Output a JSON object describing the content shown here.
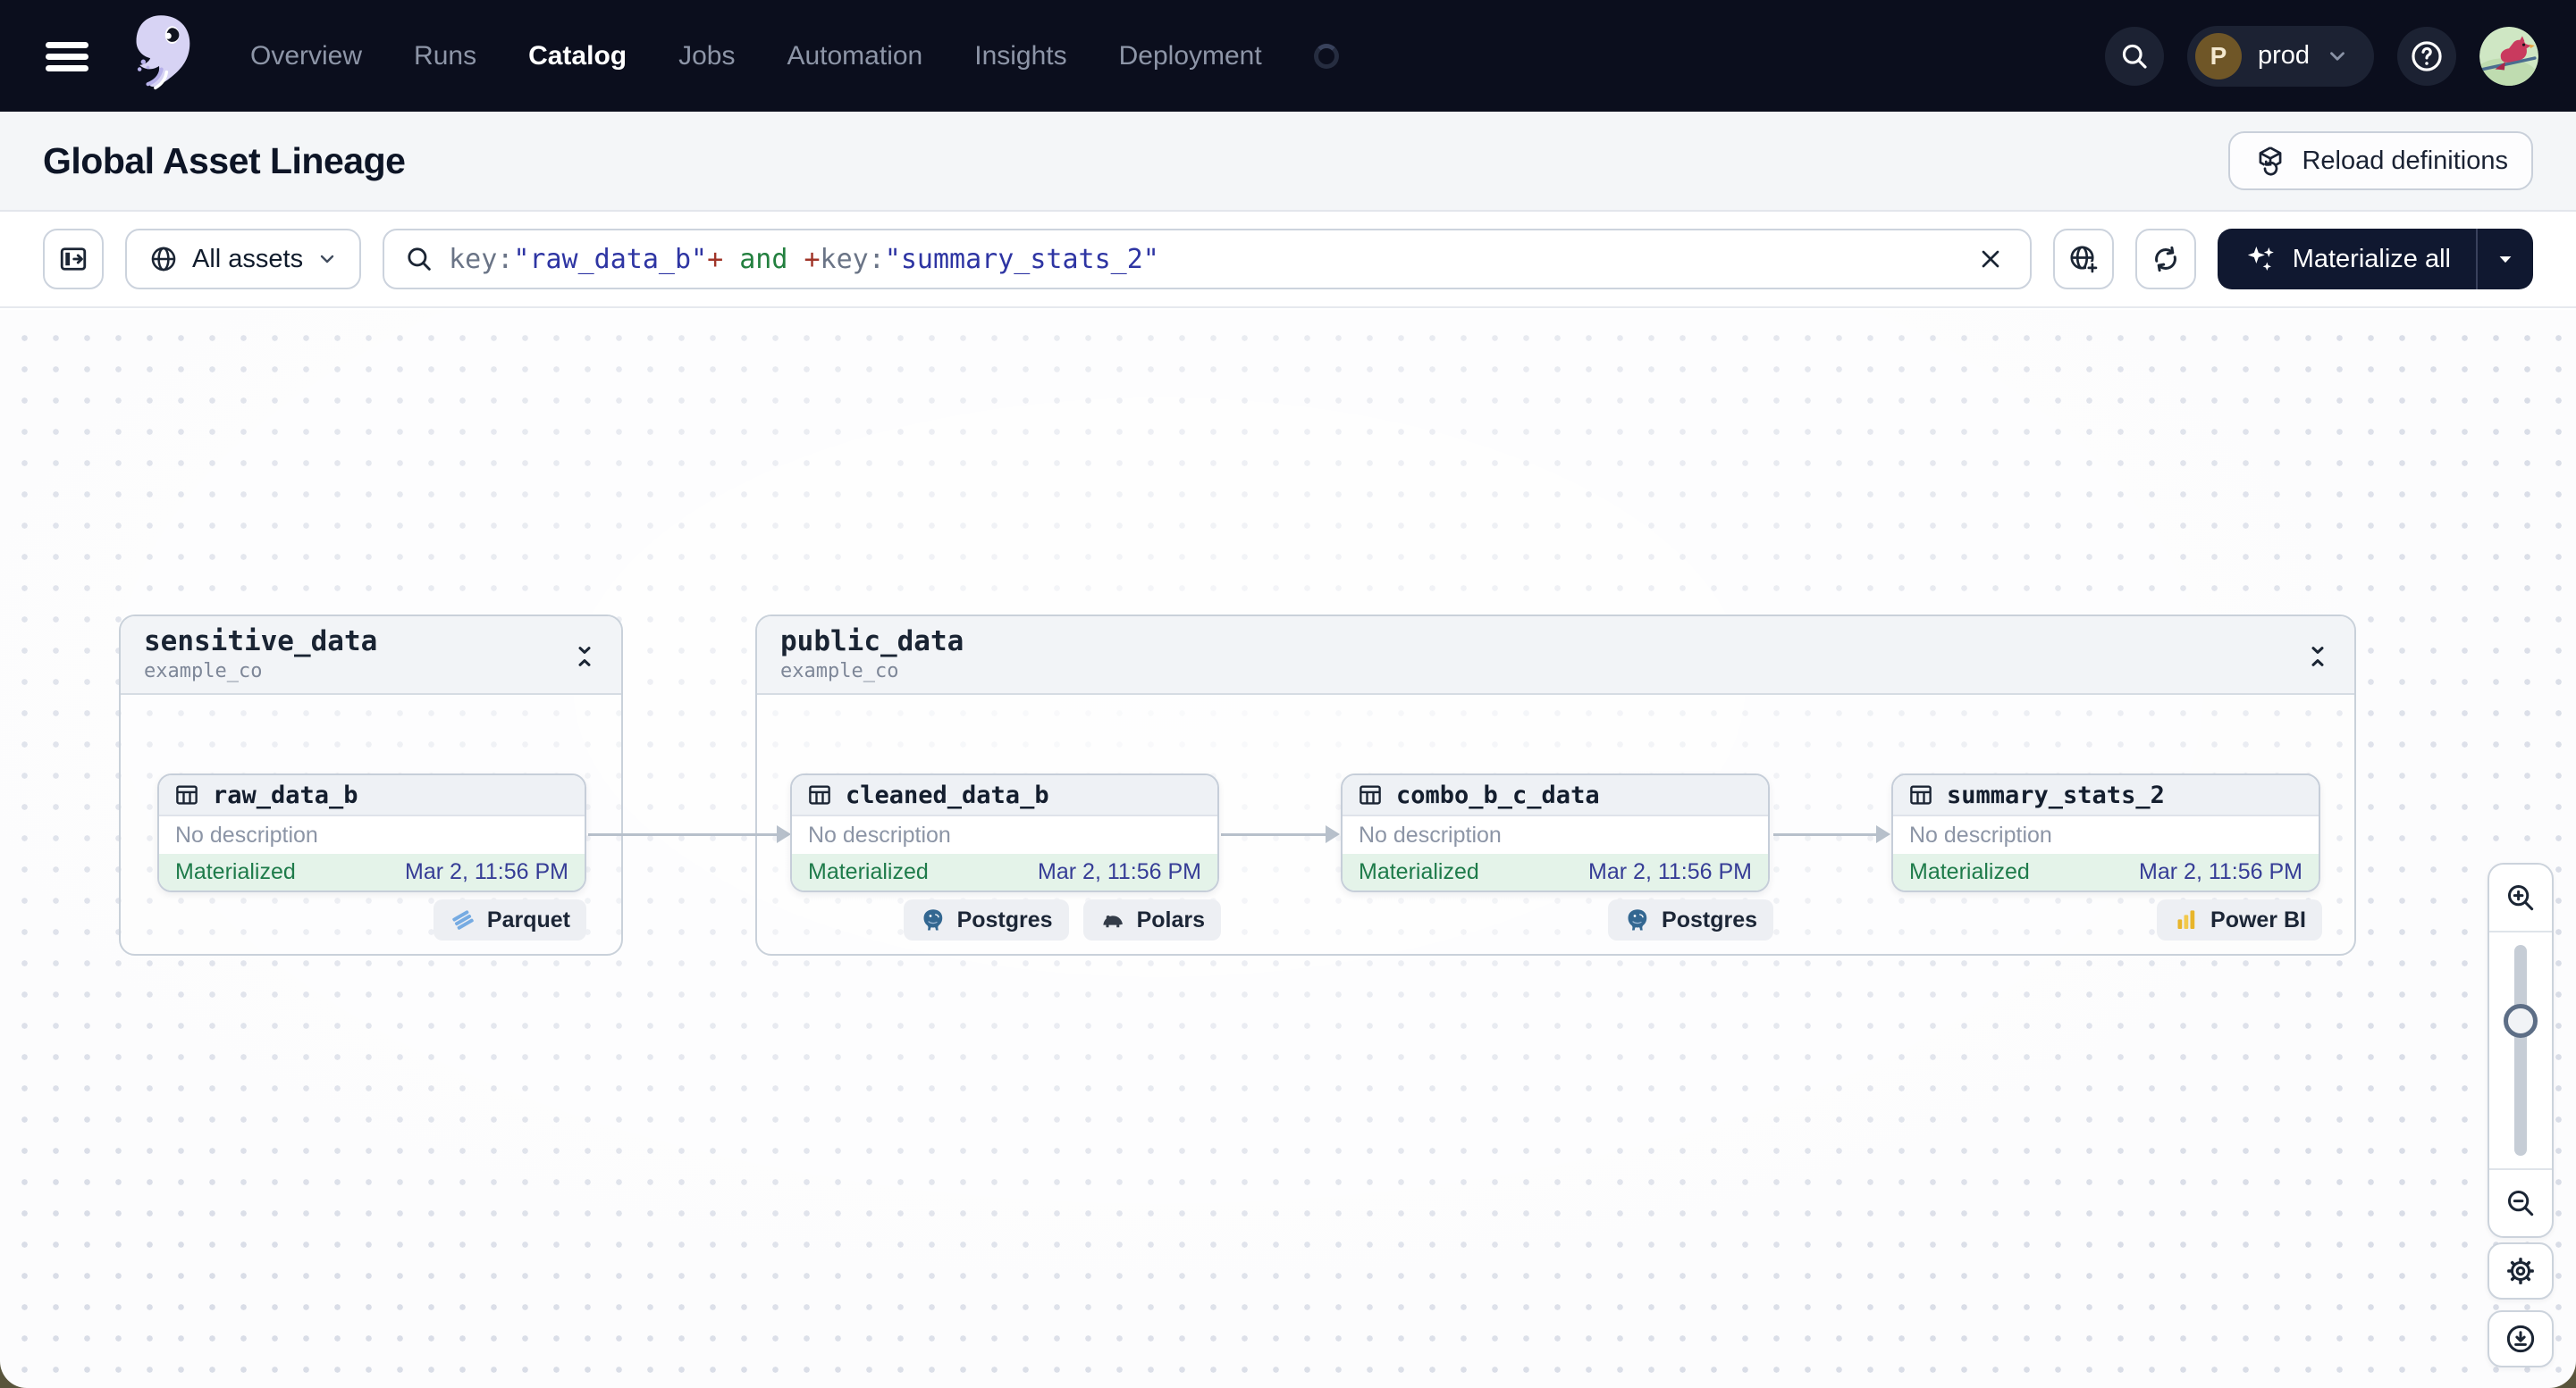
{
  "nav": {
    "menu_icon": "hamburger-icon",
    "logo_icon": "dagster-octopus-logo",
    "items": [
      {
        "label": "Overview"
      },
      {
        "label": "Runs"
      },
      {
        "label": "Catalog",
        "active": true
      },
      {
        "label": "Jobs"
      },
      {
        "label": "Automation"
      },
      {
        "label": "Insights"
      },
      {
        "label": "Deployment"
      }
    ],
    "environment": {
      "initial": "P",
      "label": "prod"
    },
    "icons": [
      "search-icon",
      "help-icon",
      "user-avatar"
    ]
  },
  "header": {
    "title": "Global Asset Lineage",
    "reload_button": "Reload definitions"
  },
  "toolbar": {
    "scope_label": "All assets",
    "search": {
      "tokens": {
        "key1": "key:",
        "value1": "\"raw_data_b\"",
        "plus1": "+",
        "op": " and ",
        "plus2": "+",
        "key2": "key:",
        "value2": "\"summary_stats_2\""
      }
    },
    "materialize_label": "Materialize all",
    "icons": [
      "panel-toggle-icon",
      "globe-icon",
      "clear-icon",
      "globe-plus-icon",
      "refresh-icon",
      "sparkles-icon",
      "caret-down-icon"
    ]
  },
  "graph": {
    "groups": [
      {
        "name": "sensitive_data",
        "owner": "example_co"
      },
      {
        "name": "public_data",
        "owner": "example_co"
      }
    ],
    "nodes": [
      {
        "name": "raw_data_b",
        "description": "No description",
        "status": "Materialized",
        "timestamp": "Mar 2, 11:56 PM",
        "tags": [
          "Parquet"
        ]
      },
      {
        "name": "cleaned_data_b",
        "description": "No description",
        "status": "Materialized",
        "timestamp": "Mar 2, 11:56 PM",
        "tags": [
          "Postgres",
          "Polars"
        ]
      },
      {
        "name": "combo_b_c_data",
        "description": "No description",
        "status": "Materialized",
        "timestamp": "Mar 2, 11:56 PM",
        "tags": [
          "Postgres"
        ]
      },
      {
        "name": "summary_stats_2",
        "description": "No description",
        "status": "Materialized",
        "timestamp": "Mar 2, 11:56 PM",
        "tags": [
          "Power BI"
        ]
      }
    ],
    "edges": [
      "raw_data_b->cleaned_data_b",
      "cleaned_data_b->combo_b_c_data",
      "combo_b_c_data->summary_stats_2"
    ],
    "controls": [
      "zoom-in-icon",
      "zoom-slider",
      "zoom-out-icon",
      "settings-gear-icon",
      "download-icon"
    ]
  },
  "colors": {
    "navbar_bg": "#0b0e1d",
    "dark_button_bg": "#101830",
    "status_materialized_bg": "#e4f3e9",
    "status_materialized_text": "#1e7b4a",
    "timestamp_text": "#363d96",
    "query_key": "#6a7486",
    "query_string": "#2e35a3",
    "query_plus": "#a03428",
    "query_and": "#23803f",
    "logo_lavender": "#d7d3f4"
  }
}
